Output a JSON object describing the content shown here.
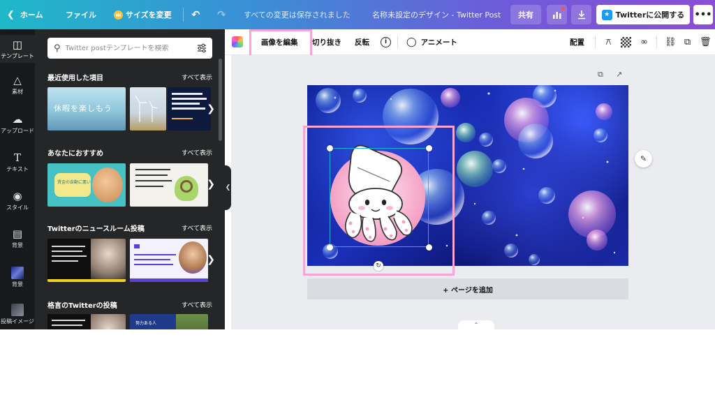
{
  "topbar": {
    "home_label": "ホーム",
    "file_label": "ファイル",
    "resize_label": "サイズを変更",
    "saved_status": "すべての変更は保存されました",
    "document_title": "名称未設定のデザイン - Twitter Post",
    "share_label": "共有",
    "publish_label": "Twitterに公開する",
    "more_label": "•••",
    "gradient_colors": [
      "#1fb8c9",
      "#3a8fd6",
      "#6e5bd8",
      "#8b4fd6"
    ]
  },
  "rail": {
    "items": [
      {
        "label": "テンプレート",
        "icon": "layout-icon"
      },
      {
        "label": "素材",
        "icon": "shapes-icon"
      },
      {
        "label": "アップロード",
        "icon": "cloud-upload-icon"
      },
      {
        "label": "テキスト",
        "icon": "text-icon"
      },
      {
        "label": "スタイル",
        "icon": "palette-icon"
      },
      {
        "label": "背景",
        "icon": "pattern-icon"
      },
      {
        "label": "背景",
        "icon": "background-thumbnail"
      },
      {
        "label": "投稿イメージ",
        "icon": "post-image-thumbnail"
      }
    ]
  },
  "panel": {
    "search_placeholder": "Twitter postテンプレートを検索",
    "see_all_label": "すべて表示",
    "sections": [
      {
        "title": "最近使用した項目"
      },
      {
        "title": "あなたにおすすめ"
      },
      {
        "title": "Twitterのニュースルーム投稿"
      },
      {
        "title": "格言のTwitterの投稿"
      }
    ],
    "thumb_texts": {
      "recent_1": "休暇を楽しもう",
      "recommend_1": "賃金の自動に悪い",
      "quote_1": "努力ある人"
    }
  },
  "editbar": {
    "edit_image_label": "画像を編集",
    "crop_label": "切り抜き",
    "flip_label": "反転",
    "animate_label": "アニメート",
    "position_label": "配置",
    "highlight_color": "#f7a6d3"
  },
  "canvas": {
    "add_page_label": "+ ページを追加",
    "selection_color": "#1ab3d6"
  }
}
